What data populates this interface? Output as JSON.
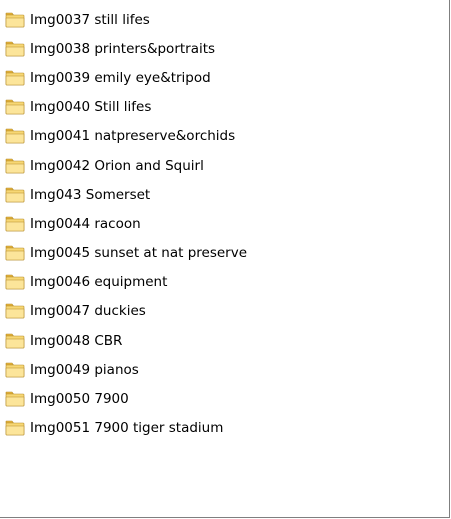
{
  "folder_list": {
    "icon": "folder-icon",
    "icon_colors": {
      "tab": "#e6b43c",
      "body": "#f7d774",
      "front": "#fce59a",
      "outline": "#b48a28"
    },
    "items": [
      {
        "label": "Img0037 still lifes"
      },
      {
        "label": "Img0038 printers&portraits"
      },
      {
        "label": "Img0039 emily eye&tripod"
      },
      {
        "label": "Img0040 Still lifes"
      },
      {
        "label": "Img0041 natpreserve&orchids"
      },
      {
        "label": "Img0042 Orion and Squirl"
      },
      {
        "label": "Img043 Somerset"
      },
      {
        "label": "Img0044 racoon"
      },
      {
        "label": "Img0045 sunset at nat preserve"
      },
      {
        "label": "Img0046 equipment"
      },
      {
        "label": "Img0047 duckies"
      },
      {
        "label": "Img0048 CBR"
      },
      {
        "label": "Img0049 pianos"
      },
      {
        "label": "Img0050 7900"
      },
      {
        "label": "Img0051 7900 tiger stadium"
      }
    ]
  }
}
